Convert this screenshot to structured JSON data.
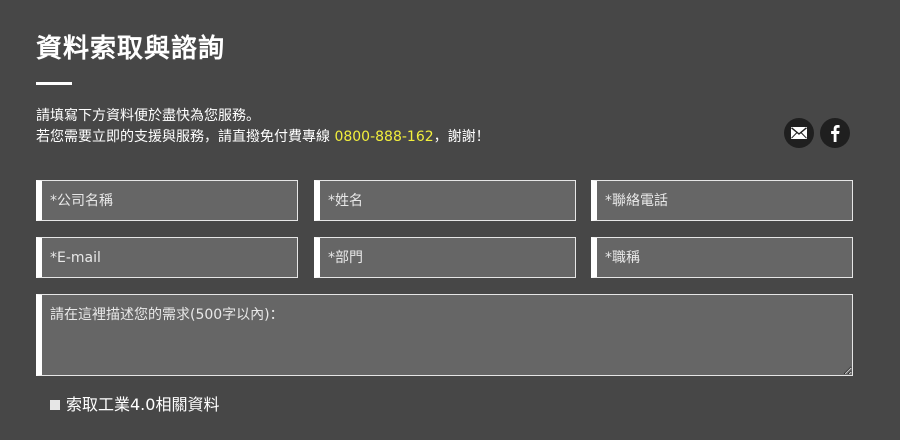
{
  "header": {
    "title": "資料索取與諮詢"
  },
  "intro": {
    "line1": "請填寫下方資料便於盡快為您服務。",
    "line2_prefix": "若您需要立即的支援與服務，請直撥免付費專線 ",
    "hotline": "0800-888-162",
    "line2_suffix": "，謝謝！"
  },
  "social": {
    "mail_icon": "mail-icon",
    "facebook_icon": "facebook-icon"
  },
  "form": {
    "company_placeholder": "*公司名稱",
    "name_placeholder": "*姓名",
    "phone_placeholder": "*聯絡電話",
    "email_placeholder": "*E-mail",
    "department_placeholder": "*部門",
    "title_placeholder": "*職稱",
    "message_placeholder": "請在這裡描述您的需求(500字以內)：",
    "checkbox_label": "索取工業4.0相關資料"
  },
  "colors": {
    "background": "#474747",
    "field_background": "#666666",
    "hotline": "#f2ef3c",
    "accent_bar": "#ffffff"
  }
}
